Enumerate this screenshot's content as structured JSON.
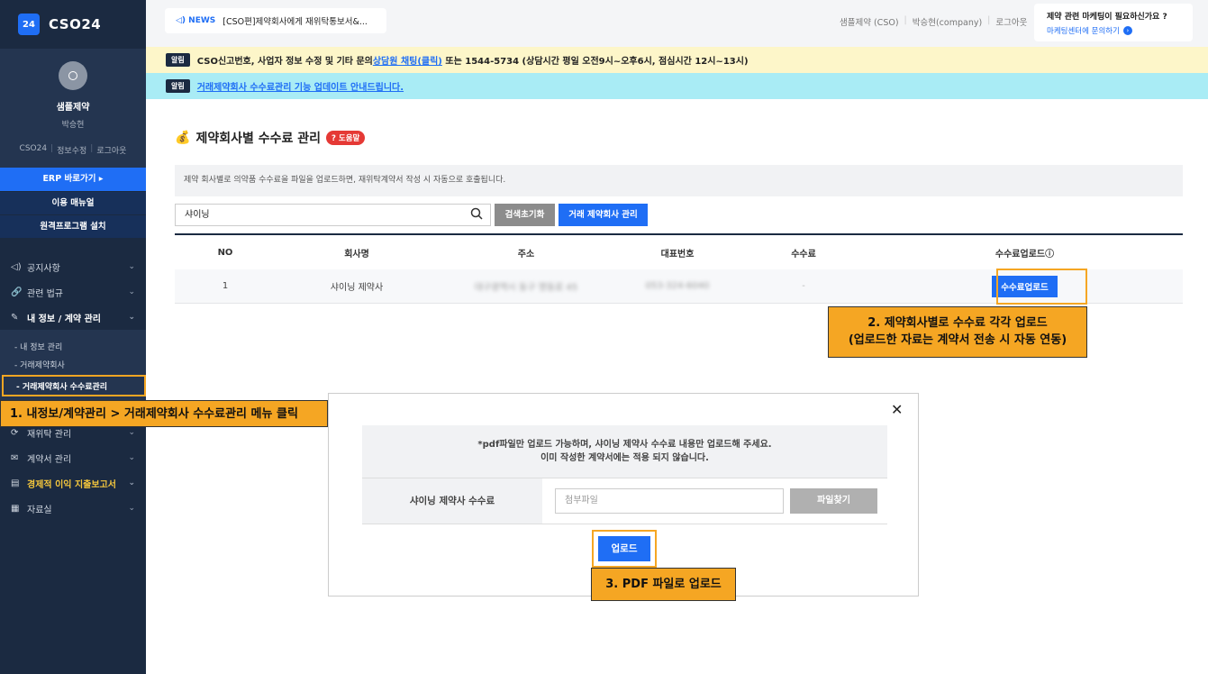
{
  "sidebar": {
    "logo_badge": "24",
    "logo_text": "CSO24",
    "profile_name": "샘플제약",
    "profile_user": "박승현",
    "profile_links": [
      "CSO24",
      "정보수정",
      "로그아웃"
    ],
    "erp_button": "ERP 바로가기 ▸",
    "manual_button": "이용 매뉴얼",
    "remote_button": "원격프로그램 설치",
    "menu": [
      {
        "icon": "◁)",
        "label": "공지사항"
      },
      {
        "icon": "🔗",
        "label": "관련 법규"
      },
      {
        "icon": "✎",
        "label": "내 정보 / 계약 관리"
      }
    ],
    "sub_items": [
      "- 내 정보 관리",
      "- 거래제약회사",
      "- 거래제약회사 수수료관리"
    ],
    "menu_after": [
      {
        "icon": "⟳",
        "label": "재위탁 관리"
      },
      {
        "icon": "✉",
        "label": "계약서 관리"
      },
      {
        "icon": "▤",
        "label": "경제적 이익 지출보고서"
      },
      {
        "icon": "▦",
        "label": "자료실"
      }
    ]
  },
  "topbar": {
    "news_tag": "NEWS",
    "news_text": "[CSO편]제약회사에게 재위탁통보서&...",
    "links": [
      "샘플제약 (CSO)",
      "박승현(company)",
      "로그아웃"
    ],
    "promo_title": "제약 관련 마케팅이 필요하신가요 ?",
    "promo_link": "마케팅센터에 문의하기"
  },
  "alerts": {
    "badge": "알림",
    "alert1_pre": "CSO신고번호, 사업자 정보 수정 및 기타 문의 ",
    "alert1_link": "상담원 채팅(클릭)",
    "alert1_post": " 또는 1544-5734 (상담시간 평일 오전9시~오후6시, 점심시간 12시~13시)",
    "alert2_link": "거래제약회사 수수료관리 기능 업데이트 안내드립니다."
  },
  "content": {
    "title_icon": "💰",
    "title": "제약회사별 수수료 관리",
    "help": "도움말",
    "description": "제약 회사별로 의약품 수수료을 파일을 업로드하면, 재위탁계약서 작성 시 자동으로 호출됩니다.",
    "search_value": "샤이닝",
    "reset_button": "검색초기화",
    "manage_button": "거래 제약회사 관리",
    "headers": [
      "NO",
      "회사명",
      "주소",
      "대표번호",
      "수수료",
      "수수료업로드ⓘ"
    ],
    "rows": [
      {
        "no": "1",
        "name": "샤이닝 제약사",
        "addr": "대구광역시 동구 명동로 45",
        "tel": "053-324-6040",
        "fee": "-",
        "upload": "수수료업로드"
      }
    ]
  },
  "modal": {
    "close": "✕",
    "note_line1": "*pdf파일만 업로드 가능하며, 샤이닝 제약사 수수료 내용만 업로드해 주세요.",
    "note_line2": "이미 작성한 계약서에는 적용 되지 않습니다.",
    "label": "샤이닝 제약사 수수료",
    "file_placeholder": "첨부파일",
    "find_button": "파일찾기",
    "upload_button": "업로드"
  },
  "callouts": {
    "c1": "1. 내정보/계약관리 > 거래제약회사 수수료관리 메뉴 클릭",
    "c2_line1": "2. 제약회사별로 수수료 각각 업로드",
    "c2_line2": "(업로드한 자료는 계약서 전송 시 자동 연동)",
    "c3": "3. PDF 파일로 업로드"
  },
  "colors": {
    "sidebar_bg": "#1b2a41",
    "accent": "#1f6ef5",
    "highlight": "#f5a623"
  }
}
